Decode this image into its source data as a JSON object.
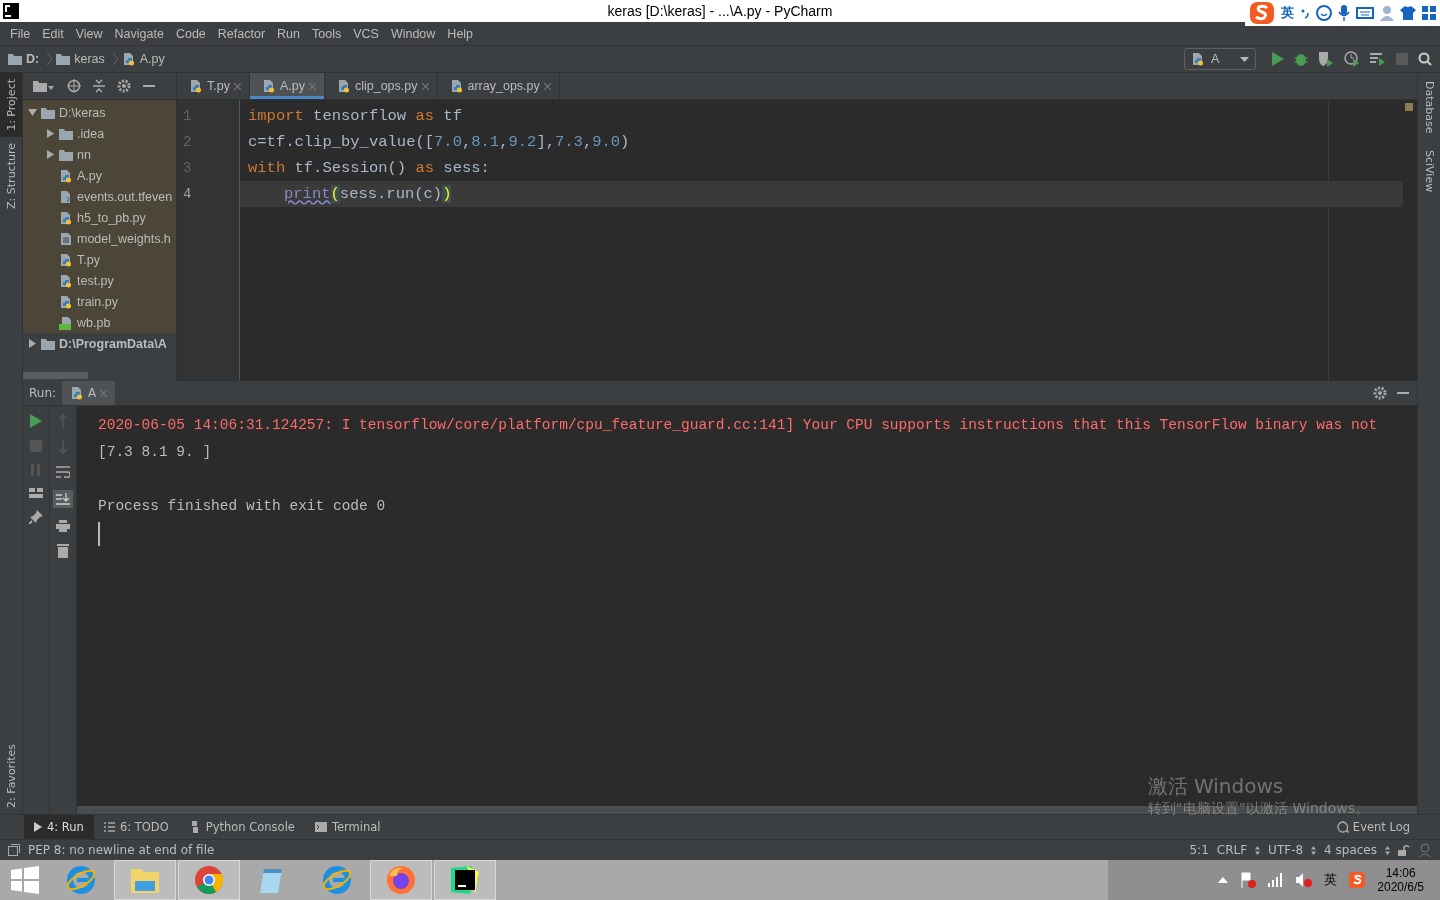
{
  "window": {
    "title": "keras [D:\\keras] - ...\\A.py - PyCharm"
  },
  "ime_bar": {
    "language": "英"
  },
  "menu": [
    {
      "label": "File"
    },
    {
      "label": "Edit"
    },
    {
      "label": "View"
    },
    {
      "label": "Navigate"
    },
    {
      "label": "Code"
    },
    {
      "label": "Refactor"
    },
    {
      "label": "Run"
    },
    {
      "label": "Tools"
    },
    {
      "label": "VCS"
    },
    {
      "label": "Window"
    },
    {
      "label": "Help"
    }
  ],
  "breadcrumbs": [
    {
      "label": "D:",
      "kind": "drive"
    },
    {
      "label": "keras",
      "kind": "folder"
    },
    {
      "label": "A.py",
      "kind": "python"
    }
  ],
  "run_config": {
    "name": "A"
  },
  "left_stripe": [
    {
      "label": "1: Project",
      "selected": true
    },
    {
      "label": "Z: Structure",
      "selected": false
    }
  ],
  "left_stripe_bottom": [
    {
      "label": "2: Favorites",
      "selected": false
    }
  ],
  "right_stripe": [
    {
      "label": "Database"
    },
    {
      "label": "SciView"
    }
  ],
  "project_tree": [
    {
      "label": "D:\\keras",
      "kind": "folder",
      "expanded": true,
      "bold": false,
      "children": [
        {
          "label": ".idea",
          "kind": "folder",
          "expanded": false
        },
        {
          "label": "nn",
          "kind": "folder",
          "expanded": false
        },
        {
          "label": "A.py",
          "kind": "python"
        },
        {
          "label": "events.out.tfeven",
          "kind": "unknown"
        },
        {
          "label": "h5_to_pb.py",
          "kind": "python"
        },
        {
          "label": "model_weights.h",
          "kind": "text"
        },
        {
          "label": "T.py",
          "kind": "python"
        },
        {
          "label": "test.py",
          "kind": "python"
        },
        {
          "label": "train.py",
          "kind": "python"
        },
        {
          "label": "wb.pb",
          "kind": "binary"
        }
      ]
    },
    {
      "label": "D:\\ProgramData\\A",
      "kind": "folder",
      "expanded": false,
      "bold": true
    }
  ],
  "editor_tabs": [
    {
      "label": "T.py",
      "selected": false
    },
    {
      "label": "A.py",
      "selected": true
    },
    {
      "label": "clip_ops.py",
      "selected": false
    },
    {
      "label": "array_ops.py",
      "selected": false
    }
  ],
  "editor": {
    "lines": [
      {
        "number": "1",
        "current": false,
        "tokens": [
          {
            "text": "import",
            "kind": "keyword"
          },
          {
            "text": " tensorflow ",
            "kind": "plain"
          },
          {
            "text": "as",
            "kind": "keyword"
          },
          {
            "text": " tf",
            "kind": "plain"
          }
        ]
      },
      {
        "number": "2",
        "current": false,
        "tokens": [
          {
            "text": "c=tf.clip_by_value([",
            "kind": "plain"
          },
          {
            "text": "7.0",
            "kind": "number"
          },
          {
            "text": ",",
            "kind": "plain"
          },
          {
            "text": "8.1",
            "kind": "number"
          },
          {
            "text": ",",
            "kind": "plain"
          },
          {
            "text": "9.2",
            "kind": "number"
          },
          {
            "text": "],",
            "kind": "plain"
          },
          {
            "text": "7.3",
            "kind": "number"
          },
          {
            "text": ",",
            "kind": "plain"
          },
          {
            "text": "9.0",
            "kind": "number"
          },
          {
            "text": ")",
            "kind": "plain"
          }
        ]
      },
      {
        "number": "3",
        "current": false,
        "tokens": [
          {
            "text": "with",
            "kind": "keyword"
          },
          {
            "text": " tf.Session() ",
            "kind": "plain"
          },
          {
            "text": "as",
            "kind": "keyword"
          },
          {
            "text": " sess:",
            "kind": "plain"
          }
        ]
      },
      {
        "number": "4",
        "current": true,
        "indented": true,
        "tokens": [
          {
            "text": "print",
            "kind": "builtin"
          },
          {
            "text": "(",
            "kind": "brace_match"
          },
          {
            "text": "sess.run(c)",
            "kind": "plain"
          },
          {
            "text": ")",
            "kind": "brace_match"
          }
        ]
      }
    ]
  },
  "run_panel": {
    "label": "Run:",
    "tabs": [
      {
        "label": "A",
        "selected": true
      }
    ],
    "output": [
      {
        "kind": "stderr",
        "text": "2020-06-05 14:06:31.124257: I tensorflow/core/platform/cpu_feature_guard.cc:141] Your CPU supports instructions that this TensorFlow binary was not"
      },
      {
        "kind": "stdout",
        "text": "[7.3 8.1 9. ]"
      },
      {
        "kind": "blank"
      },
      {
        "kind": "stdout",
        "text": "Process finished with exit code 0"
      },
      {
        "kind": "cursor"
      }
    ]
  },
  "activation_notice": {
    "title": "激活 Windows",
    "subtitle": "转到“电脑设置”以激活 Windows。"
  },
  "tool_windows": [
    {
      "label": "4: Run",
      "kind": "run",
      "selected": true
    },
    {
      "label": "6: TODO",
      "kind": "todo",
      "selected": false
    },
    {
      "label": "Python Console",
      "kind": "python",
      "selected": false
    },
    {
      "label": "Terminal",
      "kind": "terminal",
      "selected": false
    }
  ],
  "event_log": {
    "label": "Event Log"
  },
  "status_bar": {
    "message": "PEP 8: no newline at end of file",
    "position": "5:1",
    "line_separator": "CRLF",
    "encoding": "UTF-8",
    "indent": "4 spaces"
  },
  "taskbar": {
    "apps": [
      {
        "kind": "ie",
        "running": false
      },
      {
        "kind": "explorer",
        "running": true
      },
      {
        "kind": "chrome",
        "running": true
      },
      {
        "kind": "notepad",
        "running": false
      },
      {
        "kind": "ie",
        "running": false
      },
      {
        "kind": "firefox",
        "running": true
      },
      {
        "kind": "pycharm",
        "running": true
      }
    ],
    "tray": {
      "language": "英",
      "time": "14:06",
      "date": "2020/6/5"
    }
  }
}
